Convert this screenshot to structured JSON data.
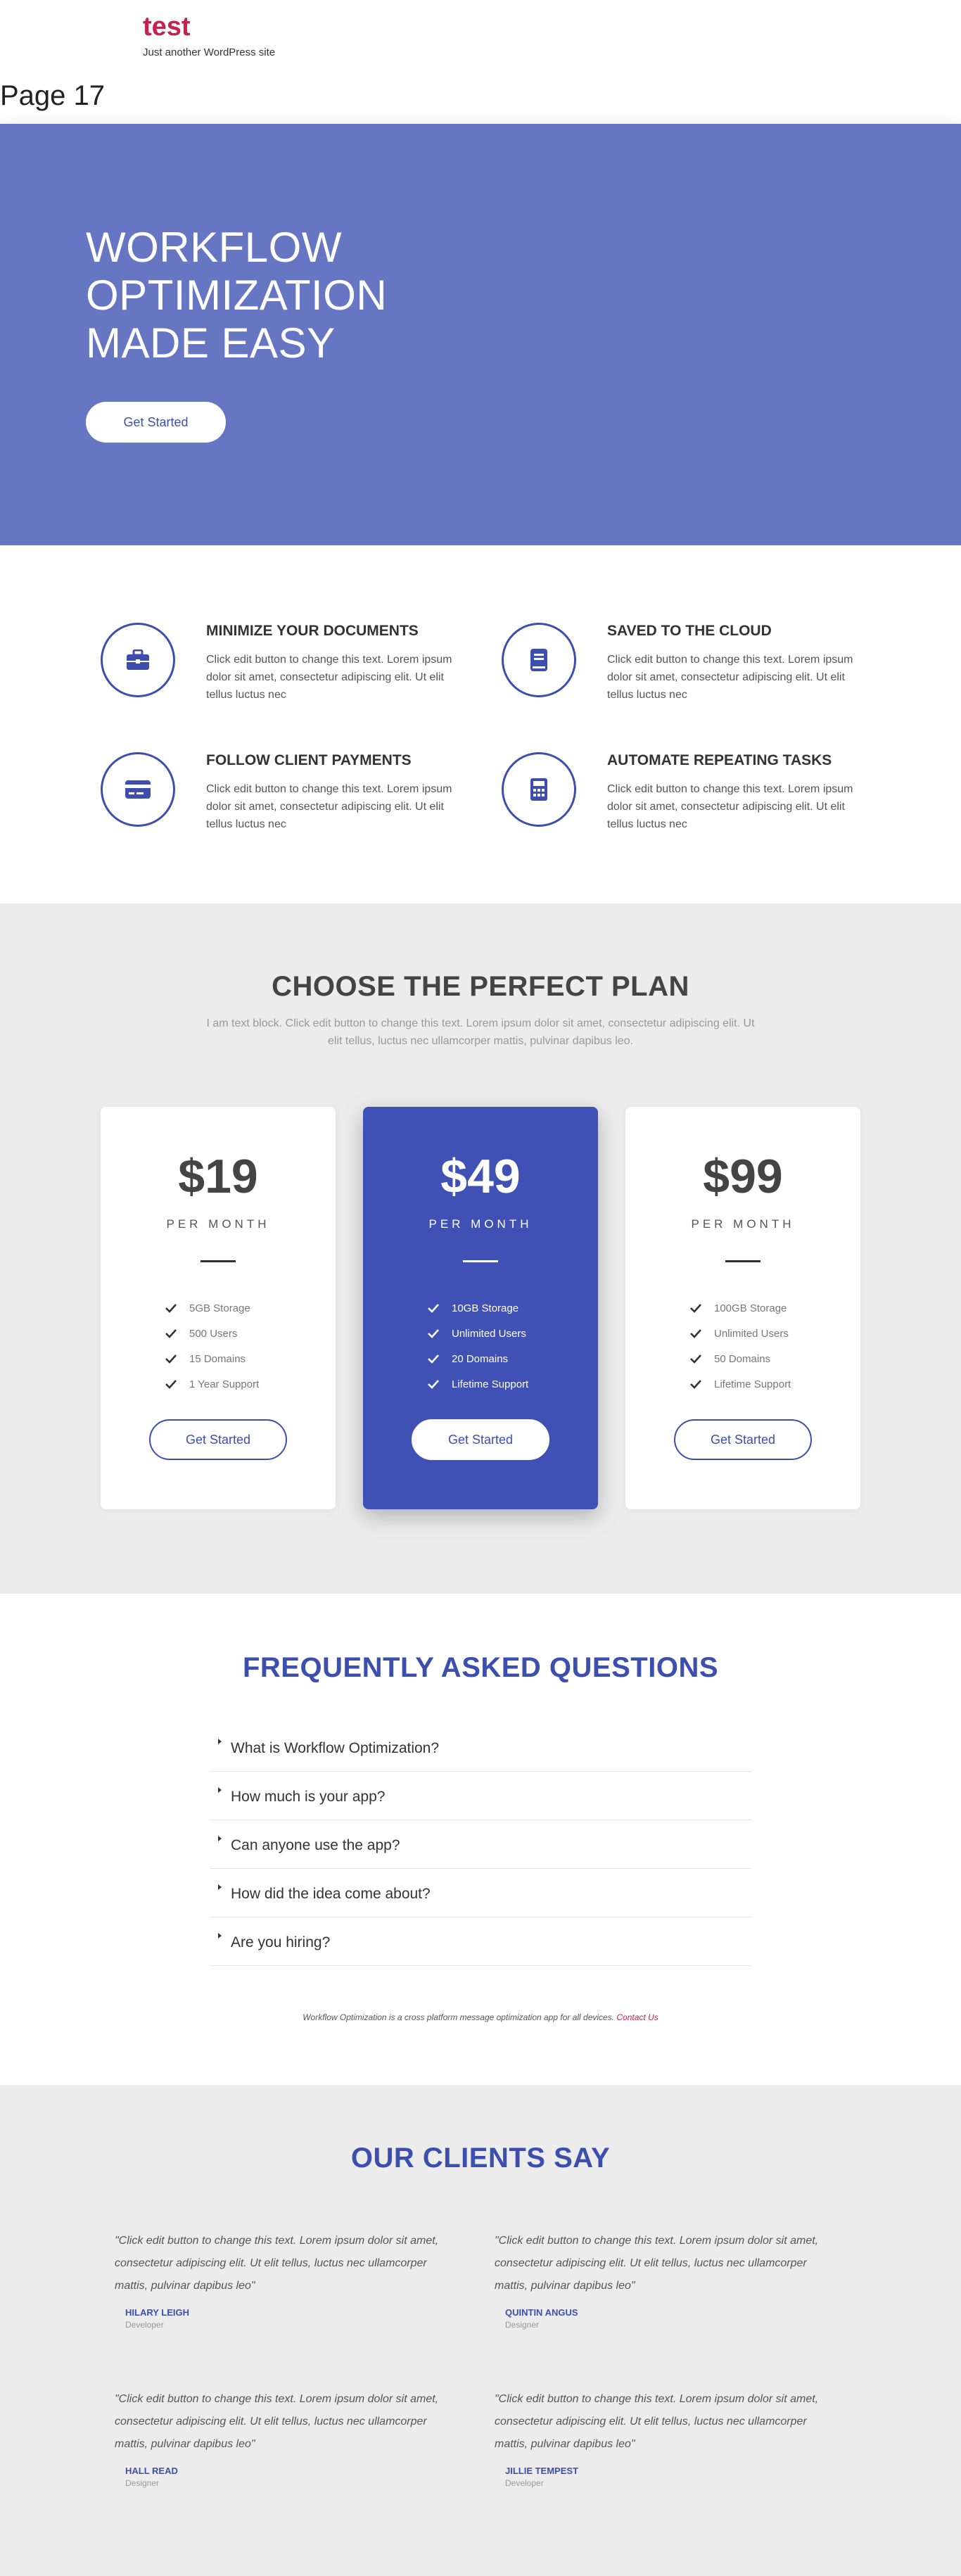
{
  "header": {
    "site_title": "test",
    "tagline": "Just another WordPress site",
    "page_title": "Page 17"
  },
  "hero": {
    "title_lines": [
      "WORKFLOW",
      "OPTIMIZATION",
      "MADE EASY"
    ],
    "cta": "Get Started",
    "bg_color": "#6776c3"
  },
  "features": [
    {
      "icon": "briefcase-icon",
      "title": "MINIMIZE YOUR DOCUMENTS",
      "text": "Click edit button to change this text. Lorem ipsum dolor sit amet, consectetur adipiscing elit. Ut elit tellus luctus nec"
    },
    {
      "icon": "book-icon",
      "title": "SAVED TO THE CLOUD",
      "text": "Click edit button to change this text. Lorem ipsum dolor sit amet, consectetur adipiscing elit. Ut elit tellus luctus nec"
    },
    {
      "icon": "credit-card-icon",
      "title": "FOLLOW CLIENT PAYMENTS",
      "text": "Click edit button to change this text. Lorem ipsum dolor sit amet, consectetur adipiscing elit. Ut elit tellus luctus nec"
    },
    {
      "icon": "calculator-icon",
      "title": "AUTOMATE REPEATING TASKS",
      "text": "Click edit button to change this text. Lorem ipsum dolor sit amet, consectetur adipiscing elit. Ut elit tellus luctus nec"
    }
  ],
  "pricing": {
    "title": "CHOOSE THE PERFECT PLAN",
    "subtitle": "I am text block. Click edit button to change this text. Lorem ipsum dolor sit amet, consectetur adipiscing elit. Ut elit tellus, luctus nec ullamcorper mattis, pulvinar dapibus leo.",
    "plans": [
      {
        "price": "$19",
        "period": "PER MONTH",
        "features": [
          "5GB Storage",
          "500 Users",
          "15 Domains",
          "1 Year Support"
        ],
        "cta": "Get Started"
      },
      {
        "price": "$49",
        "period": "PER MONTH",
        "features": [
          "10GB Storage",
          "Unlimited Users",
          "20 Domains",
          "Lifetime Support"
        ],
        "cta": "Get Started",
        "featured": true
      },
      {
        "price": "$99",
        "period": "PER MONTH",
        "features": [
          "100GB Storage",
          "Unlimited Users",
          "50 Domains",
          "Lifetime Support"
        ],
        "cta": "Get Started"
      }
    ],
    "accent": "#3f51b5"
  },
  "faq": {
    "title": "FREQUENTLY ASKED QUESTIONS",
    "questions": [
      "What is Workflow Optimization?",
      "How much is your app?",
      "Can anyone use the app?",
      "How did the idea come about?",
      "Are you hiring?"
    ],
    "note": "Workflow Optimization is a cross platform message optimization app for all devices.",
    "contact_link": "Contact Us"
  },
  "clients": {
    "title": "OUR CLIENTS SAY",
    "testimonials": [
      {
        "quote": "\"Click edit button to change this text. Lorem ipsum dolor sit amet, consectetur adipiscing elit. Ut elit tellus, luctus nec ullamcorper mattis, pulvinar dapibus leo\"",
        "name": "HILARY LEIGH",
        "role": "Developer"
      },
      {
        "quote": "\"Click edit button to change this text. Lorem ipsum dolor sit amet, consectetur adipiscing elit. Ut elit tellus, luctus nec ullamcorper mattis, pulvinar dapibus leo\"",
        "name": "QUINTIN ANGUS",
        "role": "Designer"
      },
      {
        "quote": "\"Click edit button to change this text. Lorem ipsum dolor sit amet, consectetur adipiscing elit. Ut elit tellus, luctus nec ullamcorper mattis, pulvinar dapibus leo\"",
        "name": "HALL READ",
        "role": "Designer"
      },
      {
        "quote": "\"Click edit button to change this text. Lorem ipsum dolor sit amet, consectetur adipiscing elit. Ut elit tellus, luctus nec ullamcorper mattis, pulvinar dapibus leo\"",
        "name": "JILLIE TEMPEST",
        "role": "Developer"
      }
    ]
  }
}
